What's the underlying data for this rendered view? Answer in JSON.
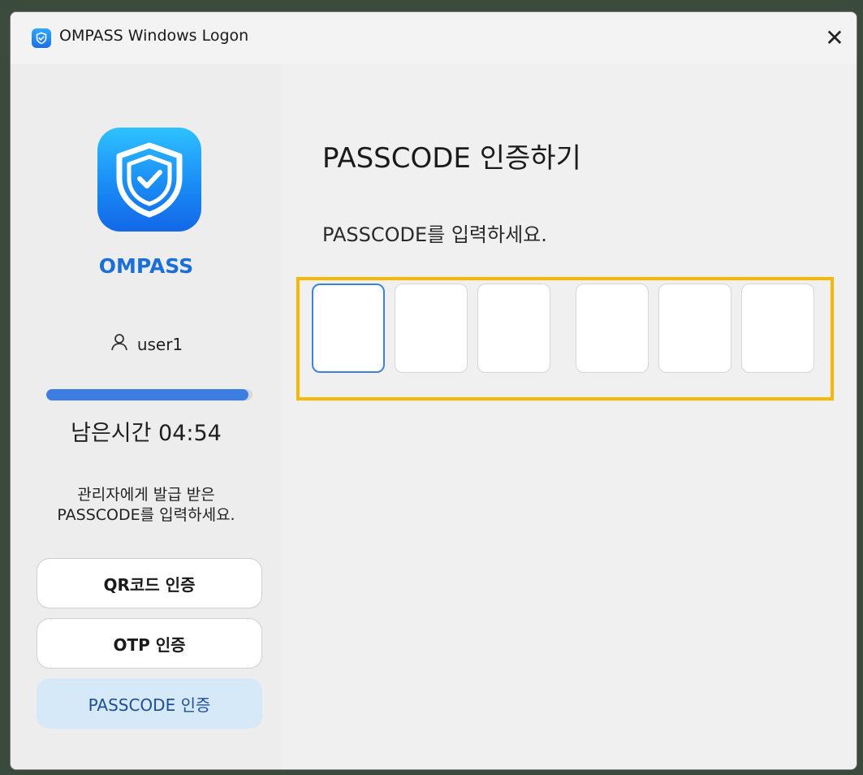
{
  "window": {
    "title": "OMPASS Windows Logon",
    "close_label": "✕"
  },
  "sidebar": {
    "brand": "OMPASS",
    "username": "user1",
    "timer": "남은시간 04:54",
    "progress": 0.98,
    "hint_line1": "관리자에게 발급 받은",
    "hint_line2": "PASSCODE를 입력하세요.",
    "buttons": [
      {
        "label": "QR코드 인증",
        "active": false
      },
      {
        "label": "OTP 인증",
        "active": false
      },
      {
        "label": "PASSCODE 인증",
        "active": true
      }
    ]
  },
  "main": {
    "title": "PASSCODE 인증하기",
    "subtitle": "PASSCODE를 입력하세요.",
    "passcode_digits": [
      "",
      "",
      "",
      "",
      "",
      ""
    ]
  },
  "colors": {
    "accent": "#1d6fd8",
    "highlight": "#f6b800",
    "active_button_bg": "#d6e9f8"
  },
  "icons": {
    "app": "shield-check-icon",
    "user": "user-icon",
    "close": "close-icon"
  }
}
